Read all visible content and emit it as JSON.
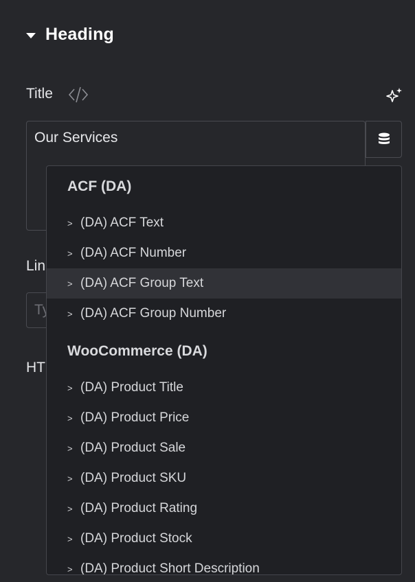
{
  "panel": {
    "section_title": "Heading",
    "title_label": "Title",
    "title_value": "Our Services",
    "link_label": "Link",
    "link_placeholder": "Type or paste your URL",
    "html_label": "HTML Tag"
  },
  "dropdown": {
    "groups": [
      {
        "title": "ACF (DA)",
        "items": [
          "(DA) ACF Text",
          "(DA) ACF Number",
          "(DA) ACF Group Text",
          "(DA) ACF Group Number"
        ]
      },
      {
        "title": "WooCommerce (DA)",
        "items": [
          "(DA) Product Title",
          "(DA) Product Price",
          "(DA) Product Sale",
          "(DA) Product SKU",
          "(DA) Product Rating",
          "(DA) Product Stock",
          "(DA) Product Short Description"
        ]
      }
    ],
    "item_prefix": ">",
    "hovered_item": "(DA) ACF Group Text"
  },
  "colors": {
    "background": "#26272b",
    "dropdown_bg": "#1f2024",
    "hover_bg": "#313237",
    "border": "#4a4b51"
  },
  "icons": [
    "caret-down-icon",
    "code-icon",
    "ai-sparkle-icon",
    "database-icon"
  ]
}
